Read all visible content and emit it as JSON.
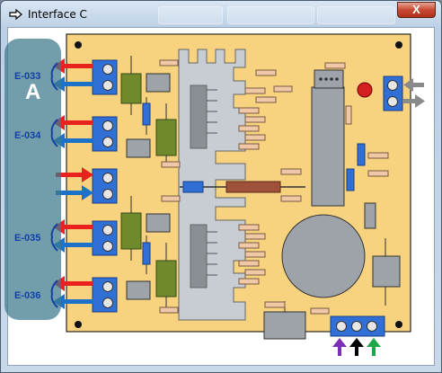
{
  "window": {
    "title": "Interface C",
    "close_label": "X"
  },
  "panel": {
    "letter": "A",
    "labels": [
      "E-033",
      "E-034",
      "E-035",
      "E-036"
    ]
  },
  "colors": {
    "board": "#f7d27f",
    "terminal": "#2f6fd6",
    "panel": "#3c788c",
    "arrow_red": "#e8221d",
    "arrow_blue": "#1c72c8",
    "arrow_gray": "#8a8a8a",
    "arrow_purple": "#7a2fb5",
    "arrow_black": "#000000",
    "arrow_green": "#1aa84a"
  }
}
